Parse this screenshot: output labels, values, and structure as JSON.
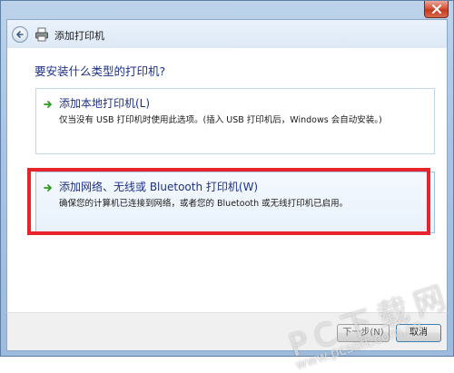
{
  "window": {
    "title": "添加打印机"
  },
  "icons": {
    "close": "close-icon",
    "back": "back-arrow-icon",
    "printer": "printer-icon",
    "option_arrow": "green-arrow-icon"
  },
  "main": {
    "question": "要安装什么类型的打印机?",
    "options": [
      {
        "title": "添加本地打印机(L)",
        "description": "仅当没有 USB 打印机时使用此选项。(插入 USB 打印机后，Windows 会自动安装。)"
      },
      {
        "title": "添加网络、无线或 Bluetooth 打印机(W)",
        "description": "确保您的计算机已连接到网络，或者您的 Bluetooth 或无线打印机已启用。"
      }
    ]
  },
  "footer": {
    "next_label": "下一步(N)",
    "cancel_label": "取消"
  },
  "watermark": {
    "brand": "PC下载网",
    "url": "www.pcsoft.com.cn"
  },
  "colors": {
    "accent_text": "#1e3287",
    "highlight": "#e8232b",
    "arrow_green": "#2e9a1f"
  }
}
